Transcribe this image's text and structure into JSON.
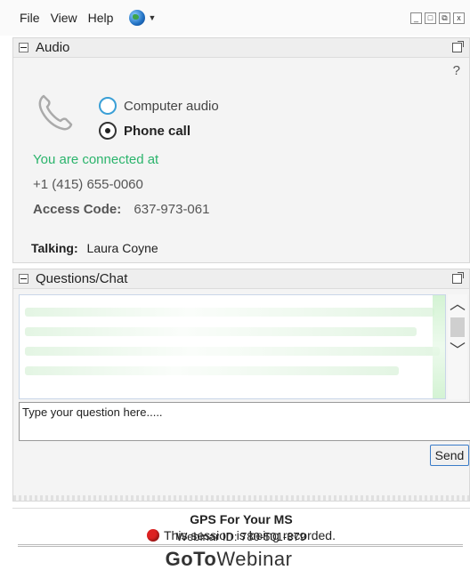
{
  "menu": {
    "file": "File",
    "view": "View",
    "help": "Help"
  },
  "window_controls": [
    "_",
    "□",
    "⧉",
    "x"
  ],
  "audio": {
    "title": "Audio",
    "help": "?",
    "options": [
      {
        "label": "Computer audio",
        "selected": false
      },
      {
        "label": "Phone call",
        "selected": true
      }
    ],
    "connected_text": "You are connected at",
    "phone_number": "+1 (415) 655-0060",
    "access_label": "Access Code:",
    "access_code": "637-973-061",
    "talking_label": "Talking:",
    "talking_name": "Laura Coyne"
  },
  "chat": {
    "title": "Questions/Chat",
    "input_value": "Type your question here.....",
    "send_label": "Send"
  },
  "session": {
    "title": "GPS For Your MS",
    "webinar_id": "Webinar ID: 780-501-379",
    "recording": "This session is being recorded."
  },
  "brand": {
    "bold": "GoTo",
    "light": "Webinar"
  },
  "colors": {
    "connected": "#2bb46c",
    "record": "#dd2222",
    "radio_accent": "#3a9fd6"
  }
}
